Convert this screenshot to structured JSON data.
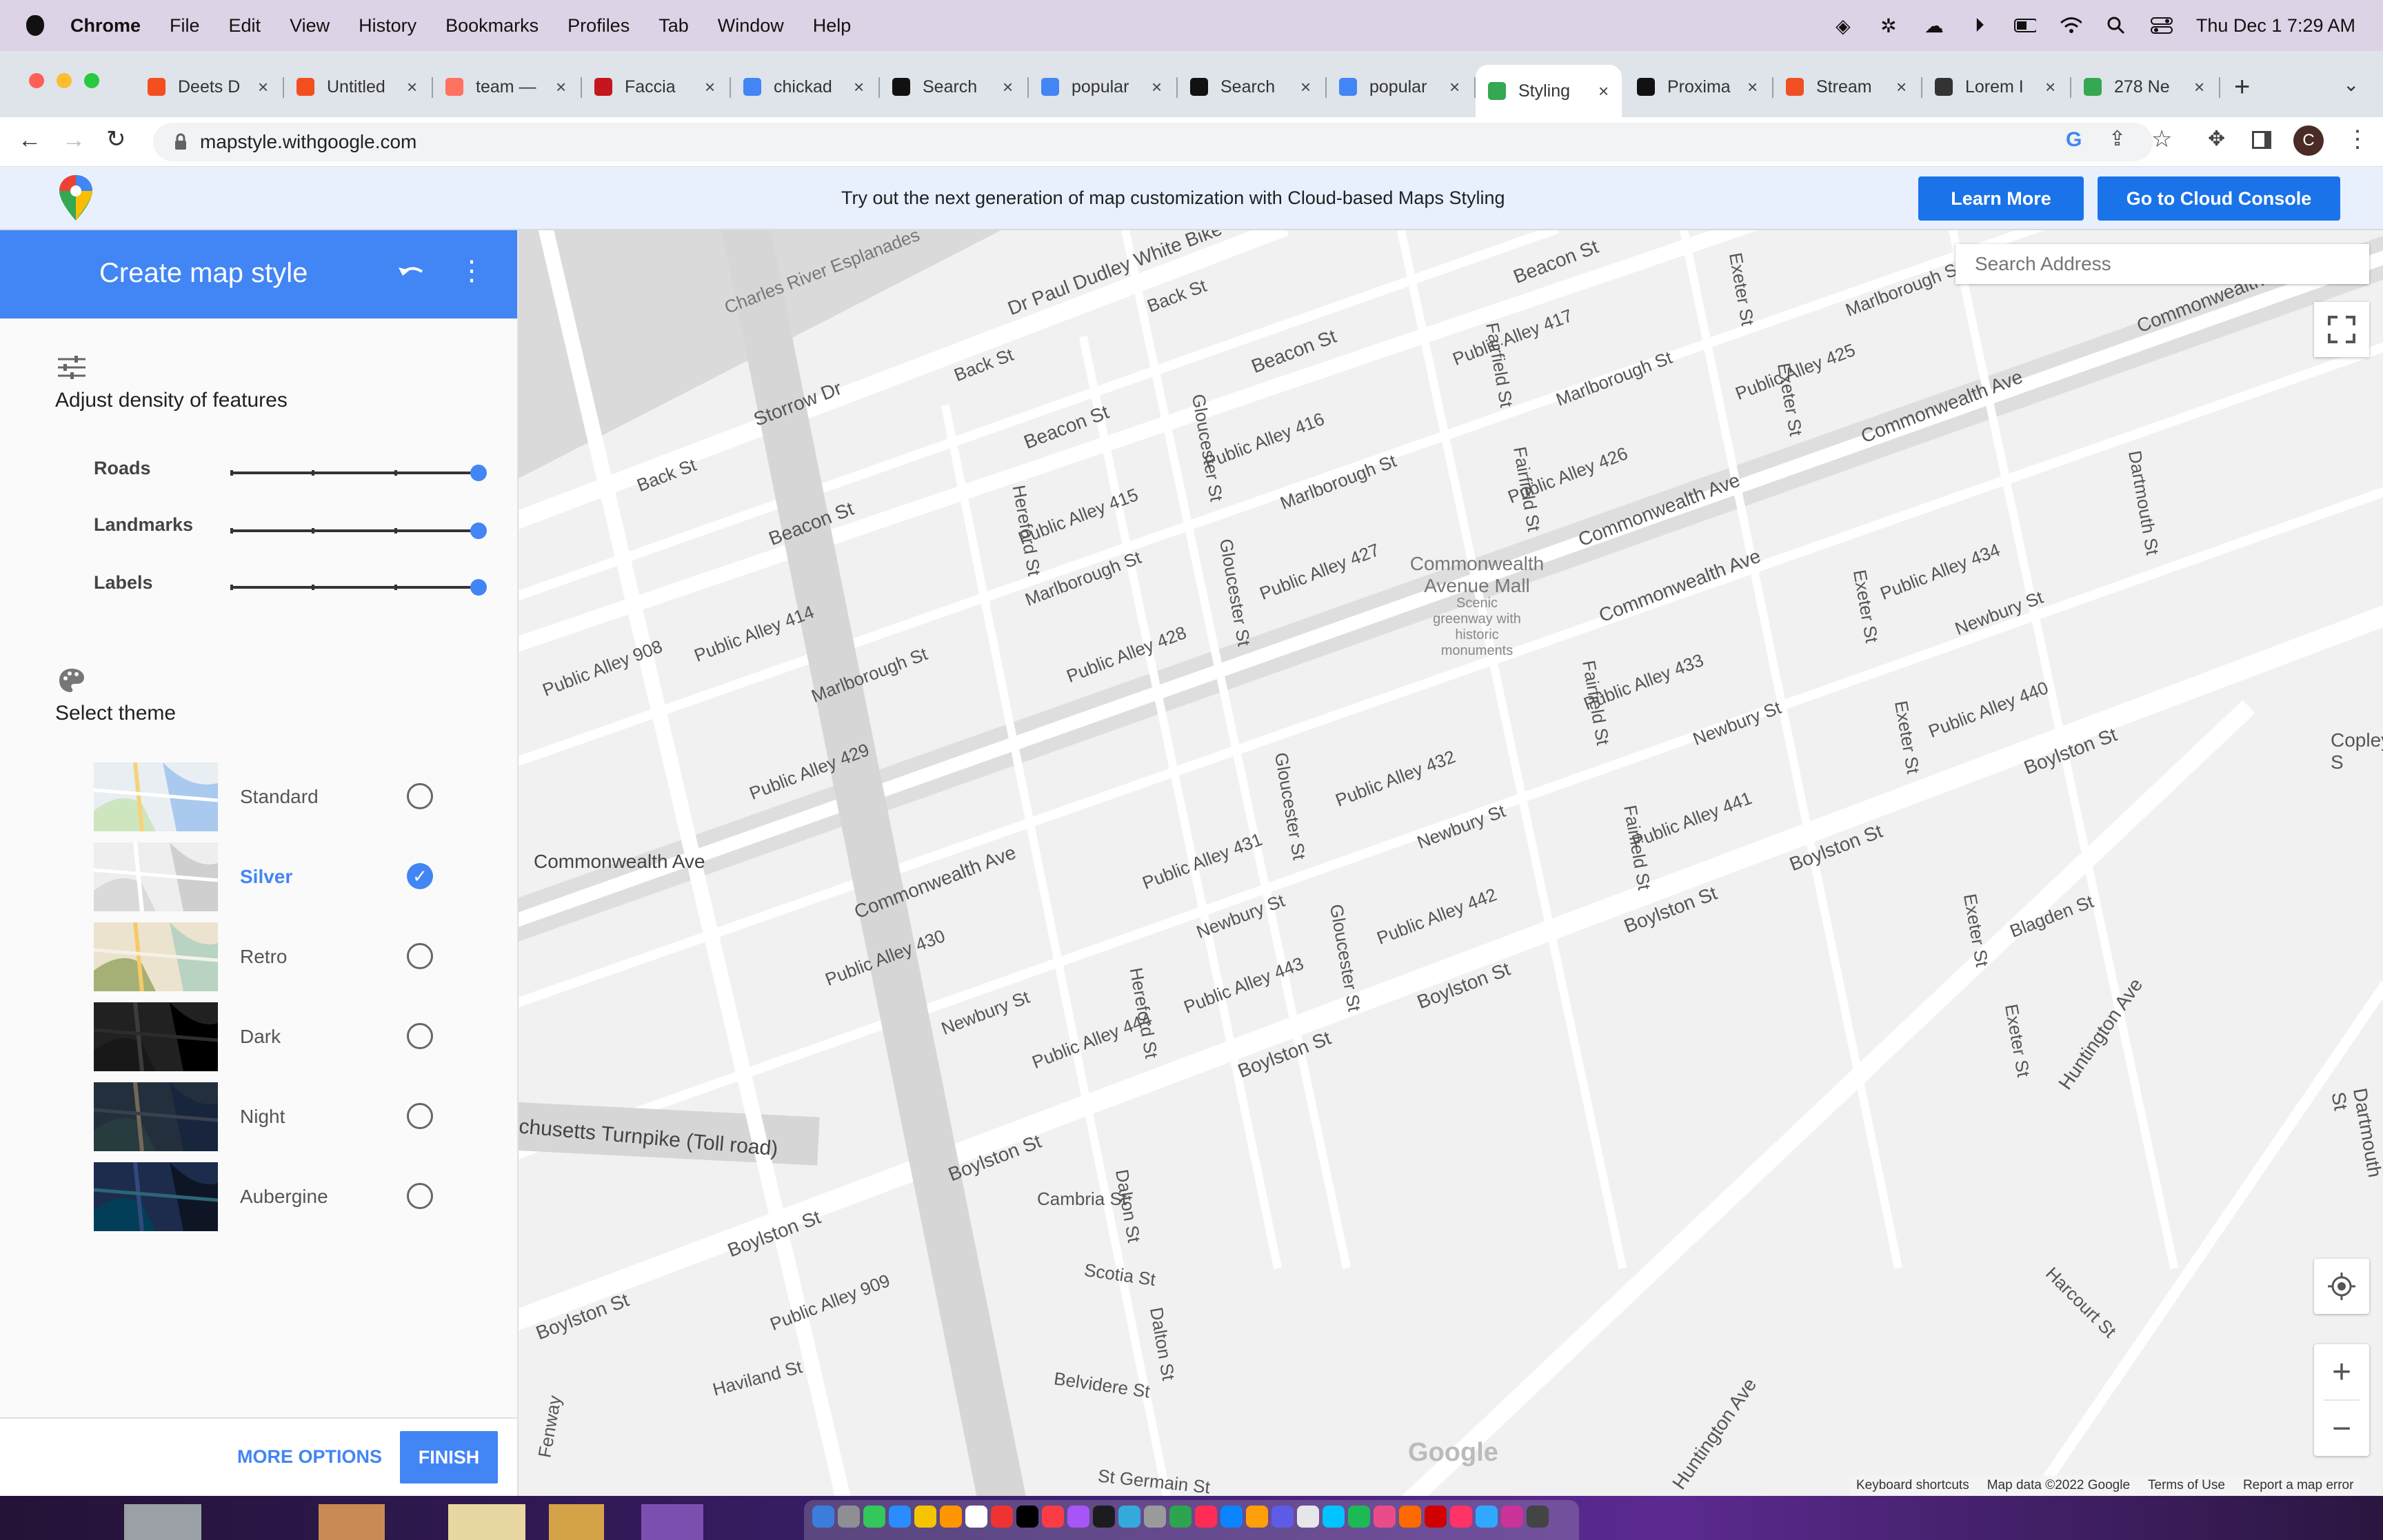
{
  "menubar": {
    "app": "Chrome",
    "items": [
      "File",
      "Edit",
      "View",
      "History",
      "Bookmarks",
      "Profiles",
      "Tab",
      "Window",
      "Help"
    ],
    "datetime": "Thu Dec 1  7:29 AM"
  },
  "tabs": [
    {
      "title": "Deets D",
      "color": "#f24e1e"
    },
    {
      "title": "Untitled",
      "color": "#f24e1e"
    },
    {
      "title": "team —",
      "color": "#ff7262"
    },
    {
      "title": "Faccia",
      "color": "#c4161c"
    },
    {
      "title": "chickad",
      "color": "#4285f4"
    },
    {
      "title": "Search",
      "color": "#111111"
    },
    {
      "title": "popular",
      "color": "#4285f4"
    },
    {
      "title": "Search",
      "color": "#111111"
    },
    {
      "title": "popular",
      "color": "#4285f4"
    },
    {
      "title": "Styling",
      "color": "#34a853"
    },
    {
      "title": "Proxima",
      "color": "#111111"
    },
    {
      "title": "Stream",
      "color": "#f04e23"
    },
    {
      "title": "Lorem I",
      "color": "#333333"
    },
    {
      "title": "278 Ne",
      "color": "#34a853"
    }
  ],
  "omnibox": {
    "url": "mapstyle.withgoogle.com",
    "profile_initial": "C"
  },
  "banner": {
    "message": "Try out the next generation of map customization with Cloud-based Maps Styling",
    "learn_more": "Learn More",
    "cloud_console": "Go to Cloud Console"
  },
  "sidebar": {
    "title": "Create map style",
    "density_title": "Adjust density of features",
    "sliders": [
      {
        "label": "Roads",
        "level": 1.0
      },
      {
        "label": "Landmarks",
        "level": 1.0
      },
      {
        "label": "Labels",
        "level": 1.0
      }
    ],
    "theme_title": "Select theme",
    "themes": [
      {
        "name": "Standard",
        "selected": false
      },
      {
        "name": "Silver",
        "selected": true
      },
      {
        "name": "Retro",
        "selected": false
      },
      {
        "name": "Dark",
        "selected": false
      },
      {
        "name": "Night",
        "selected": false
      },
      {
        "name": "Aubergine",
        "selected": false
      }
    ],
    "more_options": "MORE OPTIONS",
    "finish": "FINISH"
  },
  "map": {
    "search_placeholder": "Search Address",
    "labels": {
      "beacon": "Beacon St",
      "commonwealth": "Commonwealth Ave",
      "marlborough": "Marlborough St",
      "newbury": "Newbury St",
      "boylston": "Boylston St",
      "storrow": "Storrow Dr",
      "dudley": "Dr Paul Dudley White Bike",
      "esplanade": "Charles River Esplanades",
      "back": "Back St",
      "turnpike": "chusetts Turnpike (Toll road)",
      "hereford": "Hereford St",
      "gloucester": "Gloucester St",
      "fairfield": "Fairfield St",
      "exeter": "Exeter St",
      "dartmouth": "Dartmouth St",
      "mall": "Commonwealth Avenue Mall",
      "mall_note": "Scenic greenway with historic monuments",
      "cambria": "Cambria St",
      "scotia": "Scotia St",
      "belvidere": "Belvidere St",
      "dalton": "Dalton St",
      "huntington": "Huntington Ave",
      "harcourt": "Harcourt St",
      "blagden": "Blagden St",
      "copley": "Copley S",
      "haviland": "Haviland St",
      "stgermain": "St Germain St",
      "fenway": "Fenway",
      "pa414": "Public Alley 414",
      "pa415": "Public Alley 415",
      "pa416": "Public Alley 416",
      "pa417": "Public Alley 417",
      "pa425": "Public Alley 425",
      "pa426": "Public Alley 426",
      "pa427": "Public Alley 427",
      "pa428": "Public Alley 428",
      "pa429": "Public Alley 429",
      "pa430": "Public Alley 430",
      "pa431": "Public Alley 431",
      "pa432": "Public Alley 432",
      "pa433": "Public Alley 433",
      "pa434": "Public Alley 434",
      "pa440": "Public Alley 440",
      "pa441": "Public Alley 441",
      "pa442": "Public Alley 442",
      "pa443": "Public Alley 443",
      "pa444": "Public Alley 444",
      "pa908": "Public Alley 908",
      "pa909": "Public Alley 909",
      "watermark": "Google"
    },
    "footer": {
      "shortcuts": "Keyboard shortcuts",
      "mapdata": "Map data ©2022 Google",
      "terms": "Terms of Use",
      "report": "Report a map error"
    }
  }
}
